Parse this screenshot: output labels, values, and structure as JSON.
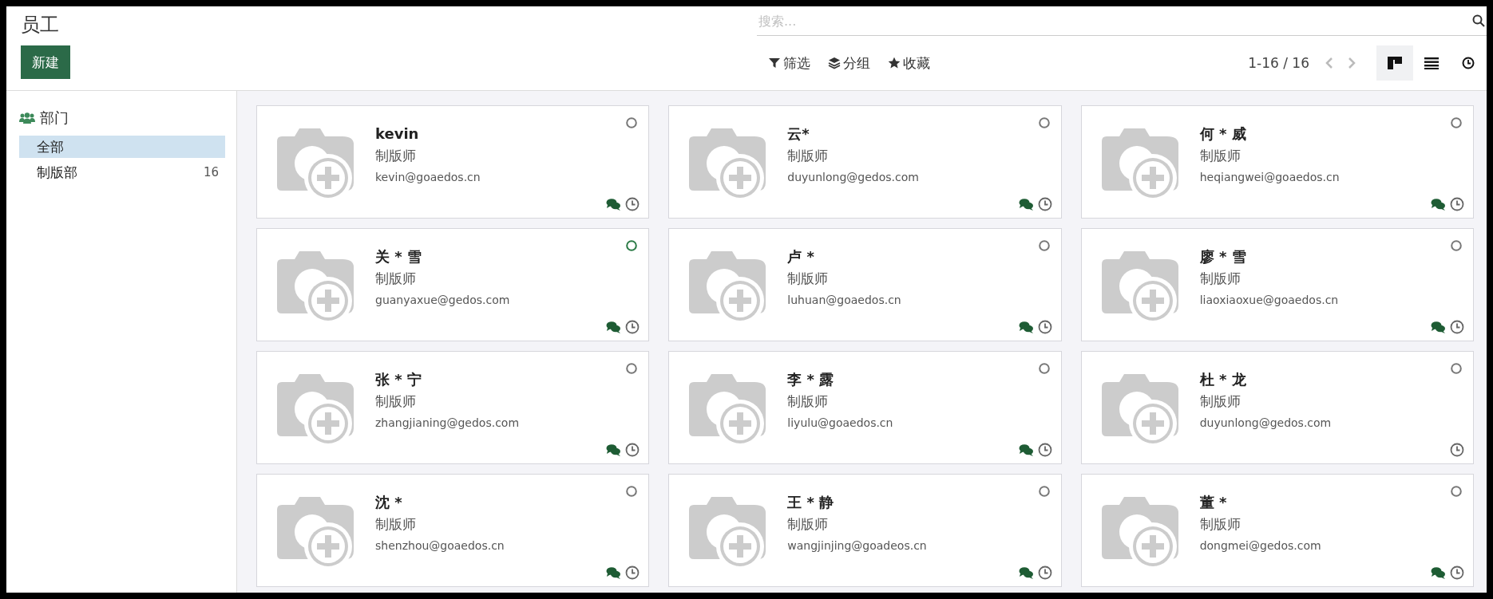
{
  "title": "员工",
  "new_button": "新建",
  "search": {
    "placeholder": "搜索..."
  },
  "toolbar": [
    {
      "kind": "filter",
      "label": "筛选"
    },
    {
      "kind": "group",
      "label": "分组"
    },
    {
      "kind": "favorite",
      "label": "收藏"
    }
  ],
  "pager": "1-16 / 16",
  "views": [
    {
      "kind": "kanban",
      "selected": true
    },
    {
      "kind": "list",
      "selected": false
    },
    {
      "kind": "activity",
      "selected": false
    }
  ],
  "sidebar": {
    "heading": "部门",
    "items": [
      {
        "label": "全部",
        "selected": true
      },
      {
        "label": "制版部",
        "count": "16",
        "selected": false
      }
    ]
  },
  "employees": [
    {
      "name": "kevin",
      "job": "制版师",
      "email": "kevin@goaedos.cn",
      "online": false,
      "has_messages": true
    },
    {
      "name": "云*",
      "job": "制版师",
      "email": "duyunlong@gedos.com",
      "online": false,
      "has_messages": true
    },
    {
      "name": "何 * 威",
      "job": "制版师",
      "email": "heqiangwei@goaedos.cn",
      "online": false,
      "has_messages": true
    },
    {
      "name": "关 * 雪",
      "job": "制版师",
      "email": "guanyaxue@gedos.com",
      "online": true,
      "has_messages": true
    },
    {
      "name": "卢 *",
      "job": "制版师",
      "email": "luhuan@goaedos.cn",
      "online": false,
      "has_messages": true
    },
    {
      "name": "廖 * 雪",
      "job": "制版师",
      "email": "liaoxiaoxue@goaedos.cn",
      "online": false,
      "has_messages": true
    },
    {
      "name": "张 * 宁",
      "job": "制版师",
      "email": "zhangjianing@gedos.com",
      "online": false,
      "has_messages": true
    },
    {
      "name": "李 * 露",
      "job": "制版师",
      "email": "liyulu@goaedos.cn",
      "online": false,
      "has_messages": true
    },
    {
      "name": "杜 * 龙",
      "job": "制版师",
      "email": "duyunlong@gedos.com",
      "online": false,
      "has_messages": false
    },
    {
      "name": "沈 *",
      "job": "制版师",
      "email": "shenzhou@goaedos.cn",
      "online": false,
      "has_messages": true
    },
    {
      "name": "王 * 静",
      "job": "制版师",
      "email": "wangjinjing@goadeos.cn",
      "online": false,
      "has_messages": true
    },
    {
      "name": "董 *",
      "job": "制版师",
      "email": "dongmei@gedos.com",
      "online": false,
      "has_messages": true
    }
  ]
}
